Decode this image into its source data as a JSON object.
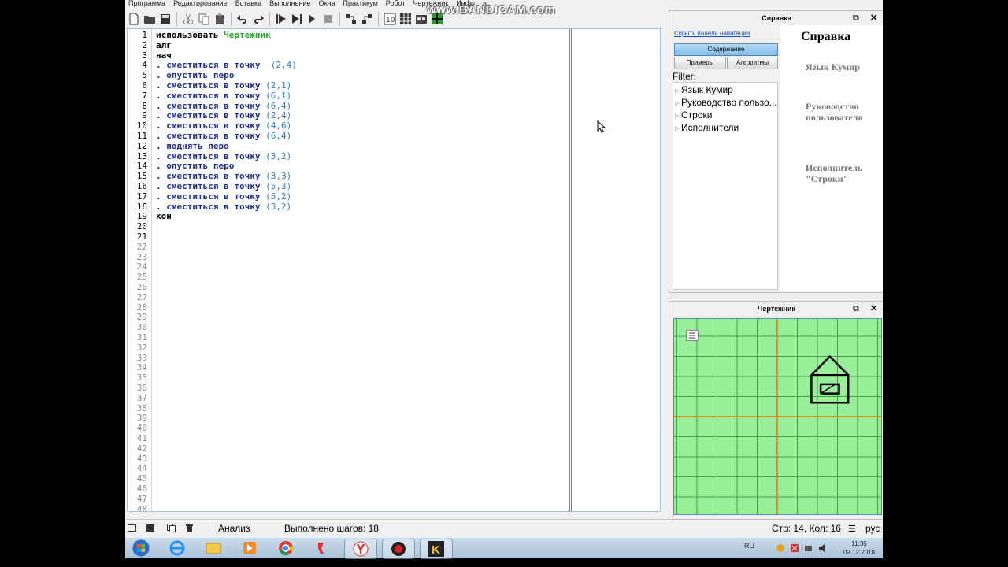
{
  "menu": [
    "Программа",
    "Редактирование",
    "Вставка",
    "Выполнение",
    "Окна",
    "Практикум",
    "Робот",
    "Чертежник",
    "Инфо",
    "»"
  ],
  "watermark": "www.BANDICAM.com",
  "editor": {
    "line_numbers": [
      "1",
      "2",
      "3",
      "4",
      "5",
      "6",
      "7",
      "8",
      "9",
      "10",
      "11",
      "12",
      "13",
      "14",
      "15",
      "16",
      "17",
      "18",
      "19",
      "20",
      "21",
      "22",
      "23",
      "24",
      "25",
      "26",
      "27",
      "28",
      "29",
      "30",
      "31",
      "32",
      "33",
      "34",
      "35",
      "36",
      "37",
      "38",
      "39",
      "40",
      "41",
      "42",
      "43",
      "44",
      "45",
      "46",
      "47",
      "48"
    ],
    "lines": [
      [
        {
          "t": "использовать ",
          "c": "k"
        },
        {
          "t": "Чертежник",
          "c": "g"
        }
      ],
      [
        {
          "t": "алг",
          "c": "k"
        }
      ],
      [
        {
          "t": "нач",
          "c": "k"
        }
      ],
      [
        {
          "t": ". ",
          "c": "b"
        },
        {
          "t": "сместиться в точку",
          "c": "b"
        },
        {
          "t": "  (",
          "c": "n"
        },
        {
          "t": "2",
          "c": "n"
        },
        {
          "t": ",",
          "c": "n"
        },
        {
          "t": "4",
          "c": "n"
        },
        {
          "t": ")",
          "c": "n"
        }
      ],
      [
        {
          "t": ". ",
          "c": "b"
        },
        {
          "t": "опустить перо",
          "c": "b"
        }
      ],
      [
        {
          "t": ". ",
          "c": "b"
        },
        {
          "t": "сместиться в точку",
          "c": "b"
        },
        {
          "t": " (",
          "c": "n"
        },
        {
          "t": "2",
          "c": "n"
        },
        {
          "t": ",",
          "c": "n"
        },
        {
          "t": "1",
          "c": "n"
        },
        {
          "t": ")",
          "c": "n"
        }
      ],
      [
        {
          "t": ". ",
          "c": "b"
        },
        {
          "t": "сместиться в точку",
          "c": "b"
        },
        {
          "t": " (",
          "c": "n"
        },
        {
          "t": "6",
          "c": "n"
        },
        {
          "t": ",",
          "c": "n"
        },
        {
          "t": "1",
          "c": "n"
        },
        {
          "t": ")",
          "c": "n"
        }
      ],
      [
        {
          "t": ". ",
          "c": "b"
        },
        {
          "t": "сместиться в точку",
          "c": "b"
        },
        {
          "t": " (",
          "c": "n"
        },
        {
          "t": "6",
          "c": "n"
        },
        {
          "t": ",",
          "c": "n"
        },
        {
          "t": "4",
          "c": "n"
        },
        {
          "t": ")",
          "c": "n"
        }
      ],
      [
        {
          "t": ". ",
          "c": "b"
        },
        {
          "t": "сместиться в точку",
          "c": "b"
        },
        {
          "t": " (",
          "c": "n"
        },
        {
          "t": "2",
          "c": "n"
        },
        {
          "t": ",",
          "c": "n"
        },
        {
          "t": "4",
          "c": "n"
        },
        {
          "t": ")",
          "c": "n"
        }
      ],
      [
        {
          "t": ". ",
          "c": "b"
        },
        {
          "t": "сместиться в точку",
          "c": "b"
        },
        {
          "t": " (",
          "c": "n"
        },
        {
          "t": "4",
          "c": "n"
        },
        {
          "t": ",",
          "c": "n"
        },
        {
          "t": "6",
          "c": "n"
        },
        {
          "t": ")",
          "c": "n"
        }
      ],
      [
        {
          "t": ". ",
          "c": "b"
        },
        {
          "t": "сместиться в точку",
          "c": "b"
        },
        {
          "t": " (",
          "c": "n"
        },
        {
          "t": "6",
          "c": "n"
        },
        {
          "t": ",",
          "c": "n"
        },
        {
          "t": "4",
          "c": "n"
        },
        {
          "t": ")",
          "c": "n"
        }
      ],
      [
        {
          "t": ". ",
          "c": "b"
        },
        {
          "t": "поднять перо",
          "c": "b"
        }
      ],
      [
        {
          "t": ". ",
          "c": "b"
        },
        {
          "t": "сместиться в точку",
          "c": "b"
        },
        {
          "t": " (",
          "c": "n"
        },
        {
          "t": "3",
          "c": "n"
        },
        {
          "t": ",",
          "c": "n"
        },
        {
          "t": "2",
          "c": "n"
        },
        {
          "t": ")",
          "c": "n"
        }
      ],
      [
        {
          "t": ". ",
          "c": "b"
        },
        {
          "t": "опустить перо",
          "c": "b"
        }
      ],
      [
        {
          "t": ". ",
          "c": "b"
        },
        {
          "t": "сместиться в точку",
          "c": "b"
        },
        {
          "t": " (",
          "c": "n"
        },
        {
          "t": "3",
          "c": "n"
        },
        {
          "t": ",",
          "c": "n"
        },
        {
          "t": "3",
          "c": "n"
        },
        {
          "t": ")",
          "c": "n"
        }
      ],
      [
        {
          "t": ". ",
          "c": "b"
        },
        {
          "t": "сместиться в точку",
          "c": "b"
        },
        {
          "t": " (",
          "c": "n"
        },
        {
          "t": "5",
          "c": "n"
        },
        {
          "t": ",",
          "c": "n"
        },
        {
          "t": "3",
          "c": "n"
        },
        {
          "t": ")",
          "c": "n"
        }
      ],
      [
        {
          "t": ". ",
          "c": "b"
        },
        {
          "t": "сместиться в точку",
          "c": "b"
        },
        {
          "t": " (",
          "c": "n"
        },
        {
          "t": "5",
          "c": "n"
        },
        {
          "t": ",",
          "c": "n"
        },
        {
          "t": "2",
          "c": "n"
        },
        {
          "t": ")",
          "c": "n"
        }
      ],
      [
        {
          "t": ". ",
          "c": "b"
        },
        {
          "t": "сместиться в точку",
          "c": "b"
        },
        {
          "t": " (",
          "c": "n"
        },
        {
          "t": "3",
          "c": "n"
        },
        {
          "t": ",",
          "c": "n"
        },
        {
          "t": "2",
          "c": "n"
        },
        {
          "t": ")",
          "c": "n"
        }
      ],
      [
        {
          "t": "кон",
          "c": "k"
        }
      ]
    ]
  },
  "status": {
    "analysis": "Анализ",
    "steps": "Выполнено шагов: 18",
    "position": "Стр: 14, Кол: 16",
    "lang": "рус"
  },
  "help_panel": {
    "title": "Справка",
    "hide_nav": "Скрыть панель навигации",
    "contents_button": "Содержание",
    "examples_button": "Примеры",
    "algorithms_button": "Алгоритмы",
    "filter_label": "Filter:",
    "tree": [
      "Язык Кумир",
      "Руководство пользо...",
      "Строки",
      "Исполнители"
    ],
    "content_heading": "Справка",
    "content_links": [
      "Язык Кумир",
      "Руководство пользователя",
      "Исполнитель \"Строки\""
    ]
  },
  "drawer_panel": {
    "title": "Чертежник",
    "colors": {
      "background": "#99ee99",
      "grid": "#46a046",
      "axis": "#e07a10",
      "pen": "#000000"
    }
  },
  "taskbar": {
    "tray_lang": "RU",
    "time": "11:35",
    "date": "02.12.2018"
  }
}
